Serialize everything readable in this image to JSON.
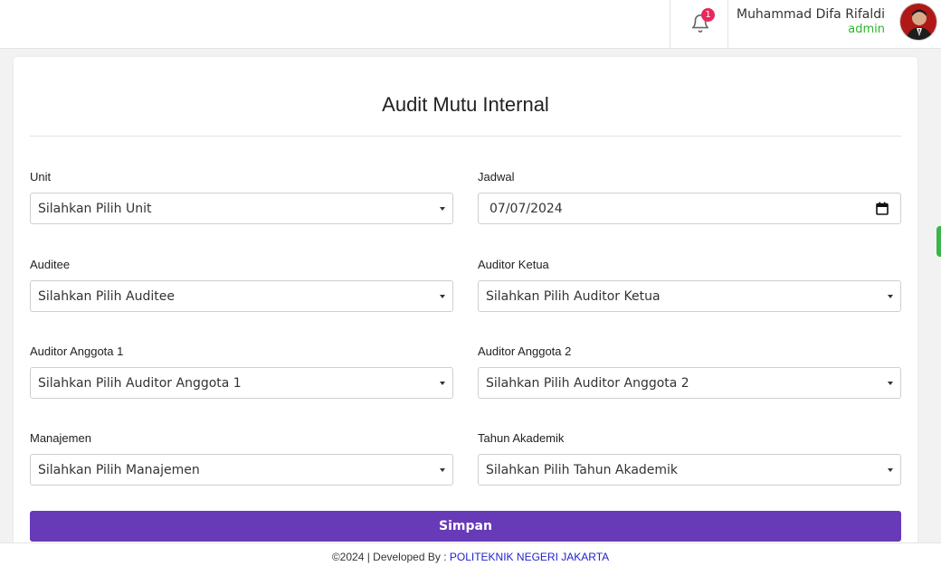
{
  "header": {
    "notification_count": "1",
    "user_name": "Muhammad Difa Rifaldi",
    "user_role": "admin",
    "bell_icon": "bell-icon",
    "avatar_icon": "user-avatar"
  },
  "form": {
    "title": "Audit Mutu Internal",
    "fields": {
      "unit": {
        "label": "Unit",
        "value": "Silahkan Pilih Unit"
      },
      "jadwal": {
        "label": "Jadwal",
        "value": "07/07/2024"
      },
      "auditee": {
        "label": "Auditee",
        "value": "Silahkan Pilih Auditee"
      },
      "auditor_ketua": {
        "label": "Auditor Ketua",
        "value": "Silahkan Pilih Auditor Ketua"
      },
      "auditor_anggota_1": {
        "label": "Auditor Anggota 1",
        "value": "Silahkan Pilih Auditor Anggota 1"
      },
      "auditor_anggota_2": {
        "label": "Auditor Anggota 2",
        "value": "Silahkan Pilih Auditor Anggota 2"
      },
      "manajemen": {
        "label": "Manajemen",
        "value": "Silahkan Pilih Manajemen"
      },
      "tahun_akademik": {
        "label": "Tahun Akademik",
        "value": "Silahkan Pilih Tahun Akademik"
      }
    },
    "submit_label": "Simpan"
  },
  "footer": {
    "prefix": "©2024 | Developed By : ",
    "link": "POLITEKNIK NEGERI JAKARTA"
  },
  "colors": {
    "primary": "#673ab7",
    "role": "#2db52d",
    "badge": "#e8275b",
    "link": "#2222cc"
  }
}
